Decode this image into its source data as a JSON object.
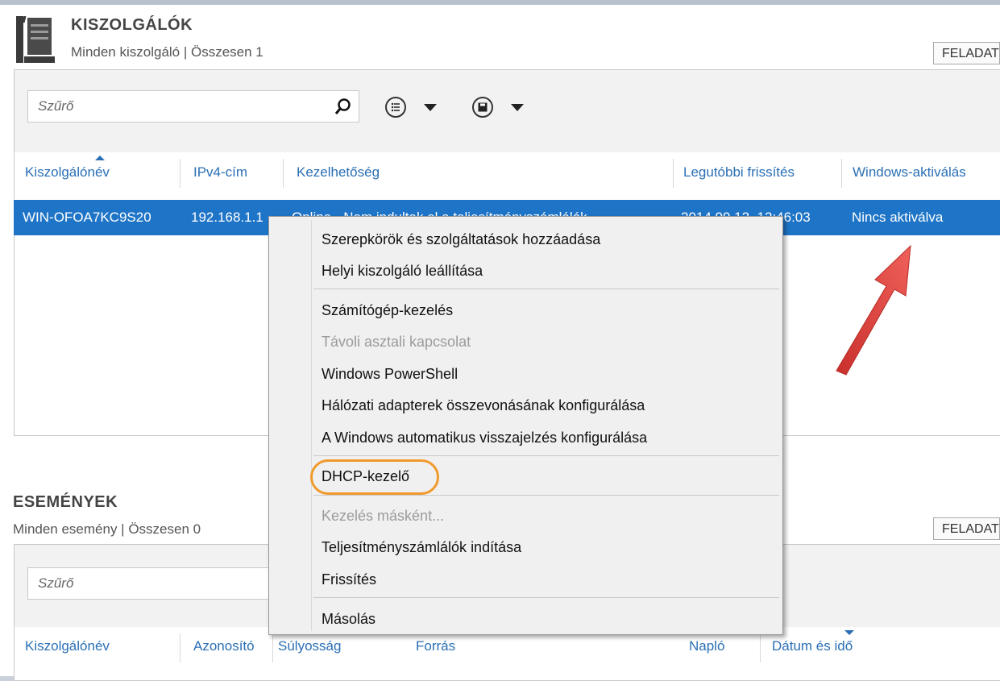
{
  "servers_section": {
    "title": "KISZOLGÁLÓK",
    "subtitle": "Minden kiszolgáló | Összesen 1",
    "tasks_label": "FELADATOK",
    "filter_placeholder": "Szűrő",
    "columns": [
      "Kiszolgálónév",
      "IPv4-cím",
      "Kezelhetőség",
      "Legutóbbi frissítés",
      "Windows-aktiválás"
    ],
    "row": {
      "name": "WIN-OFOA7KC9S20",
      "ip": "192.168.1.1",
      "manageability": "Online - Nem indultak el a teljesítményszámlálók",
      "last_update": "2014.09.12. 12:46:03",
      "activation": "Nincs aktiválva"
    }
  },
  "events_section": {
    "title": "ESEMÉNYEK",
    "subtitle": "Minden esemény | Összesen 0",
    "tasks_label": "FELADATOK",
    "filter_placeholder": "Szűrő",
    "columns": [
      "Kiszolgálónév",
      "Azonosító",
      "Súlyosság",
      "Forrás",
      "Napló",
      "Dátum és idő"
    ]
  },
  "context_menu": {
    "items": [
      {
        "label": "Szerepkörök és szolgáltatások hozzáadása",
        "enabled": true
      },
      {
        "label": "Helyi kiszolgáló leállítása",
        "enabled": true
      },
      {
        "label": "Számítógép-kezelés",
        "enabled": true
      },
      {
        "label": "Távoli asztali kapcsolat",
        "enabled": false
      },
      {
        "label": "Windows PowerShell",
        "enabled": true
      },
      {
        "label": "Hálózati adapterek összevonásának konfigurálása",
        "enabled": true
      },
      {
        "label": "A Windows automatikus visszajelzés konfigurálása",
        "enabled": true
      },
      {
        "label": "DHCP-kezelő",
        "enabled": true,
        "highlighted": true
      },
      {
        "label": "Kezelés másként...",
        "enabled": false
      },
      {
        "label": "Teljesítményszámlálók indítása",
        "enabled": true
      },
      {
        "label": "Frissítés",
        "enabled": true
      },
      {
        "label": "Másolás",
        "enabled": true
      }
    ]
  },
  "colors": {
    "selection": "#1e74c6",
    "header_text": "#2a6fb5",
    "highlight_oval": "#f09a2c",
    "annotation_arrow": "#e0453a"
  },
  "icons": [
    "server-tools-icon",
    "search-icon",
    "list-view-icon",
    "save-icon",
    "dropdown-caret-icon",
    "annotation-arrow-icon"
  ]
}
